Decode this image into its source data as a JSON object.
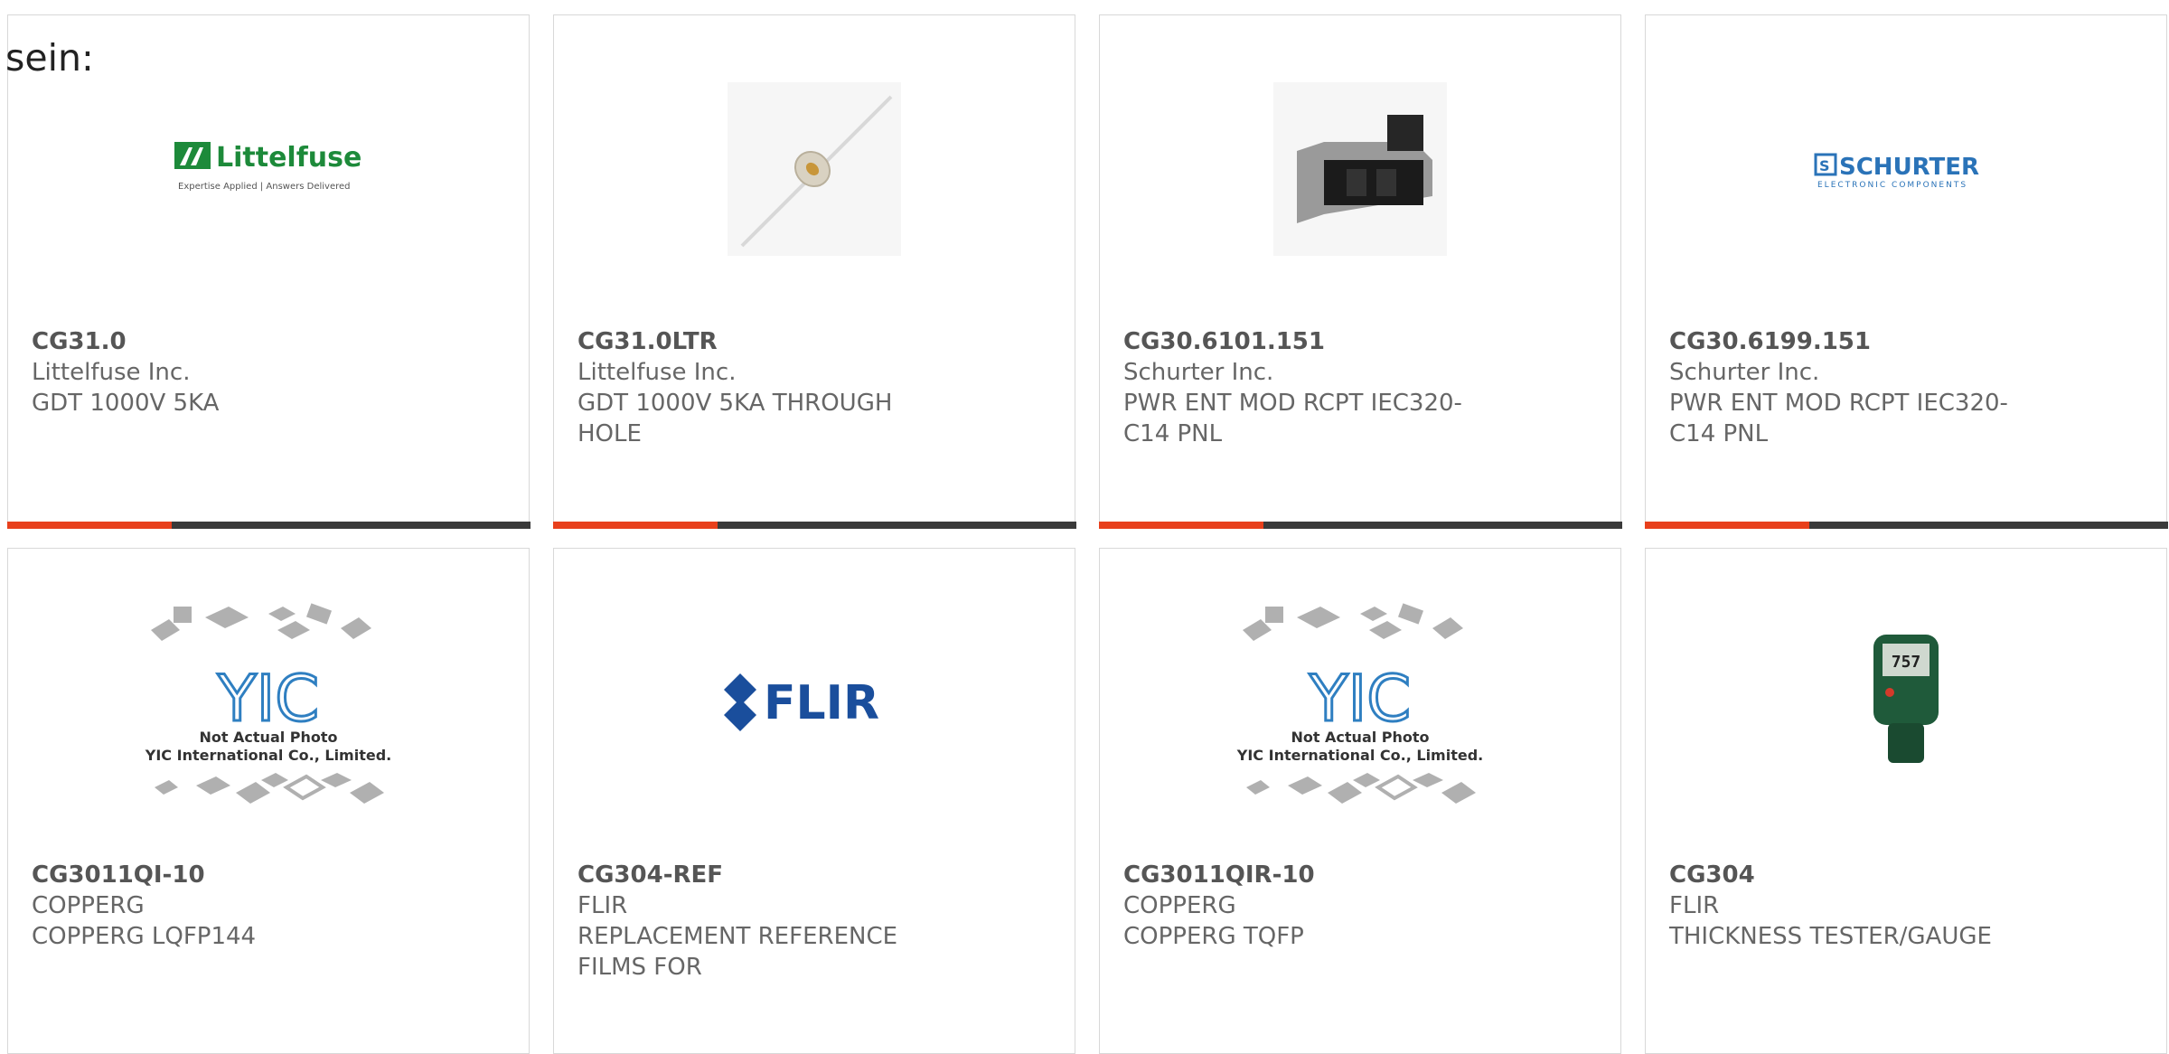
{
  "page": {
    "fragment_text": "sein:"
  },
  "products": [
    {
      "part": "CG31.0",
      "maker": "Littelfuse Inc.",
      "desc": "GDT 1000V 5KA",
      "image": "littelfuse-logo",
      "slogan": "Expertise Applied | Answers Delivered",
      "logo_text": "Littelfuse"
    },
    {
      "part": "CG31.0LTR",
      "maker": "Littelfuse Inc.",
      "desc": "GDT 1000V 5KA THROUGH HOLE",
      "image": "gas-discharge-tube-photo"
    },
    {
      "part": "CG30.6101.151",
      "maker": "Schurter Inc.",
      "desc": "PWR ENT MOD RCPT IEC320-C14 PNL",
      "image": "power-entry-module-photo"
    },
    {
      "part": "CG30.6199.151",
      "maker": "Schurter Inc.",
      "desc": "PWR ENT MOD RCPT IEC320-C14 PNL",
      "image": "schurter-logo",
      "logo_text": "SCHURTER",
      "logo_sub": "ELECTRONIC COMPONENTS"
    },
    {
      "part": "CG3011QI-10",
      "maker": "COPPERG",
      "desc": "COPPERG LQFP144",
      "image": "yic-placeholder",
      "note1": "Not Actual Photo",
      "note2": "YIC International Co., Limited."
    },
    {
      "part": "CG304-REF",
      "maker": "FLIR",
      "desc": "REPLACEMENT REFERENCE FILMS FOR",
      "image": "flir-logo",
      "logo_text": "FLIR"
    },
    {
      "part": "CG3011QIR-10",
      "maker": "COPPERG",
      "desc": "COPPERG TQFP",
      "image": "yic-placeholder",
      "note1": "Not Actual Photo",
      "note2": "YIC International Co., Limited."
    },
    {
      "part": "CG304",
      "maker": "FLIR",
      "desc": "THICKNESS TESTER/GAUGE",
      "image": "thickness-gauge-photo",
      "gauge_readout": "757"
    }
  ],
  "progress": {
    "fraction": 0.315
  },
  "colors": {
    "accent": "#e8401c",
    "bar": "#3a3a3a",
    "littelfuse_green": "#1d8a3a",
    "schurter_blue": "#2a73b8",
    "flir_blue": "#1a4e9c",
    "yic_blue": "#2f7fc1"
  }
}
